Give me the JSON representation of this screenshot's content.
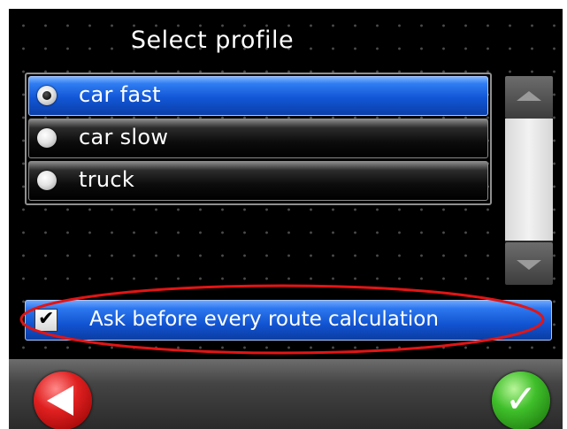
{
  "header": {
    "title": "Select profile"
  },
  "profiles": {
    "items": [
      {
        "label": "car fast",
        "selected": true
      },
      {
        "label": "car slow",
        "selected": false
      },
      {
        "label": "truck",
        "selected": false
      }
    ]
  },
  "scrollbar": {
    "up_icon": "arrow-up-icon",
    "down_icon": "arrow-down-icon"
  },
  "option": {
    "label": "Ask before every route calculation",
    "checked": true,
    "check_glyph": "✔"
  },
  "footer": {
    "back_icon": "back-arrow-icon",
    "ok_icon": "checkmark-icon",
    "ok_glyph": "✓"
  },
  "colors": {
    "background": "#000000",
    "selection_blue": "#1256d6",
    "highlight_ellipse": "#e31414",
    "back_red": "#e02020",
    "ok_green": "#3fbf2a"
  }
}
